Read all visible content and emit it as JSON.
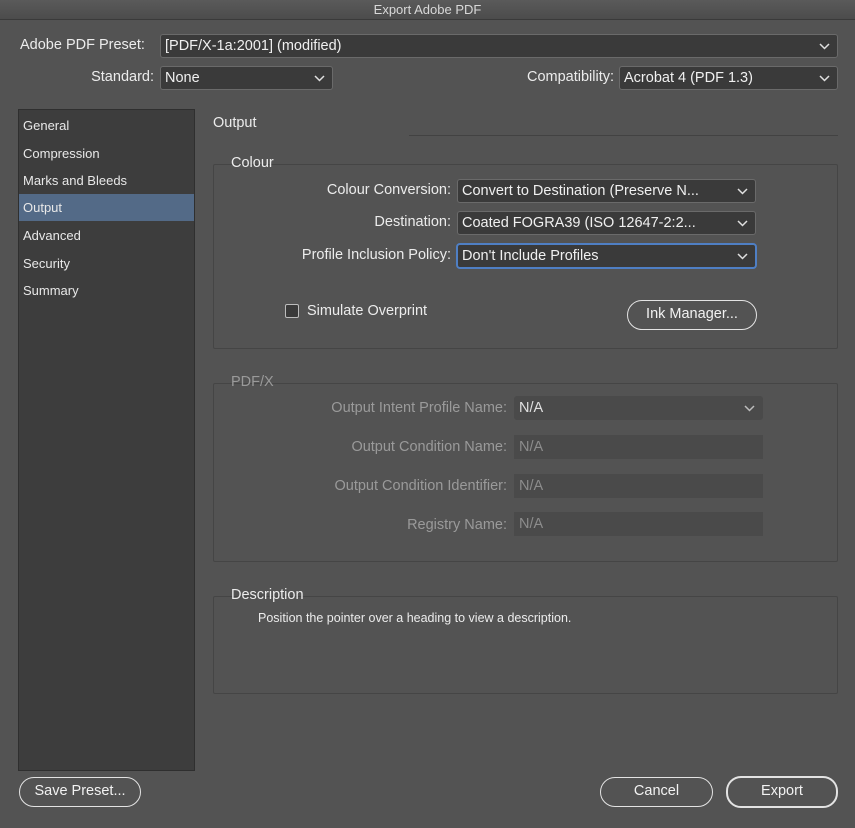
{
  "window": {
    "title": "Export Adobe PDF"
  },
  "header": {
    "preset_label": "Adobe PDF Preset:",
    "preset_value": "[PDF/X-1a:2001] (modified)",
    "standard_label": "Standard:",
    "standard_value": "None",
    "compatibility_label": "Compatibility:",
    "compatibility_value": "Acrobat 4 (PDF 1.3)"
  },
  "sidebar": {
    "items": [
      {
        "label": "General"
      },
      {
        "label": "Compression"
      },
      {
        "label": "Marks and Bleeds"
      },
      {
        "label": "Output",
        "selected": true
      },
      {
        "label": "Advanced"
      },
      {
        "label": "Security"
      },
      {
        "label": "Summary"
      }
    ]
  },
  "main": {
    "title": "Output",
    "colour": {
      "title": "Colour",
      "conversion_label": "Colour Conversion:",
      "conversion_value": "Convert to Destination (Preserve N...",
      "destination_label": "Destination:",
      "destination_value": "Coated FOGRA39 (ISO 12647-2:2...",
      "profile_label": "Profile Inclusion Policy:",
      "profile_value": "Don't Include Profiles",
      "simulate_label": "Simulate Overprint",
      "simulate_checked": false,
      "ink_manager_label": "Ink Manager..."
    },
    "pdfx": {
      "title": "PDF/X",
      "intent_label": "Output Intent Profile Name:",
      "intent_value": "N/A",
      "condition_label": "Output Condition Name:",
      "condition_value": "N/A",
      "identifier_label": "Output Condition Identifier:",
      "identifier_value": "N/A",
      "registry_label": "Registry Name:",
      "registry_value": "N/A"
    },
    "description": {
      "title": "Description",
      "text": "Position the pointer over a heading to view a description."
    }
  },
  "footer": {
    "save_preset_label": "Save Preset...",
    "cancel_label": "Cancel",
    "export_label": "Export"
  },
  "colors": {
    "selection": "#536a87",
    "focus": "#4f7fc4",
    "background": "#535353"
  }
}
